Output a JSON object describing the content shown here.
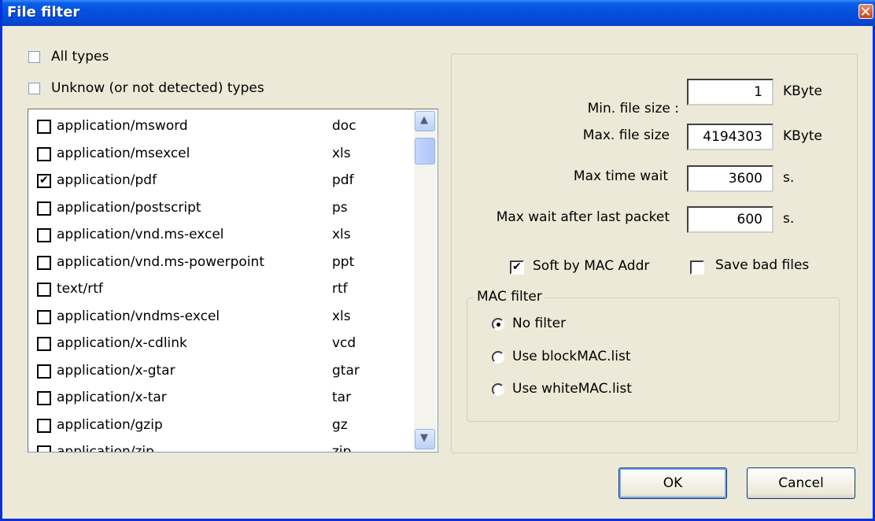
{
  "window": {
    "title": "File filter"
  },
  "checks": {
    "all_types": {
      "label": "All types",
      "checked": false
    },
    "unknown_types": {
      "label": "Unknow (or not detected) types",
      "checked": false
    }
  },
  "mime_list": [
    {
      "mime": "application/msword",
      "ext": "doc",
      "checked": false
    },
    {
      "mime": "application/msexcel",
      "ext": "xls",
      "checked": false
    },
    {
      "mime": "application/pdf",
      "ext": "pdf",
      "checked": true
    },
    {
      "mime": "application/postscript",
      "ext": "ps",
      "checked": false
    },
    {
      "mime": "application/vnd.ms-excel",
      "ext": "xls",
      "checked": false
    },
    {
      "mime": "application/vnd.ms-powerpoint",
      "ext": "ppt",
      "checked": false
    },
    {
      "mime": "text/rtf",
      "ext": "rtf",
      "checked": false
    },
    {
      "mime": "application/vndms-excel",
      "ext": "xls",
      "checked": false
    },
    {
      "mime": "application/x-cdlink",
      "ext": "vcd",
      "checked": false
    },
    {
      "mime": "application/x-gtar",
      "ext": "gtar",
      "checked": false
    },
    {
      "mime": "application/x-tar",
      "ext": "tar",
      "checked": false
    },
    {
      "mime": "application/gzip",
      "ext": "gz",
      "checked": false
    },
    {
      "mime": "application/zip",
      "ext": "zip",
      "checked": false
    }
  ],
  "settings": {
    "min_size": {
      "label": "Min. file size :",
      "value": "1",
      "unit": "KByte"
    },
    "max_size": {
      "label": "Max. file size",
      "value": "4194303",
      "unit": "KByte"
    },
    "max_time": {
      "label": "Max time wait",
      "value": "3600",
      "unit": "s."
    },
    "max_after": {
      "label": "Max wait after last packet",
      "value": "600",
      "unit": "s."
    },
    "soft_by_mac": {
      "label": "Soft by MAC Addr",
      "checked": true
    },
    "save_bad": {
      "label": "Save bad files",
      "checked": false
    }
  },
  "mac_filter": {
    "legend": "MAC filter",
    "options": [
      {
        "label": "No filter",
        "selected": true
      },
      {
        "label": "Use blockMAC.list",
        "selected": false
      },
      {
        "label": "Use whiteMAC.list",
        "selected": false
      }
    ]
  },
  "buttons": {
    "ok": "OK",
    "cancel": "Cancel"
  }
}
